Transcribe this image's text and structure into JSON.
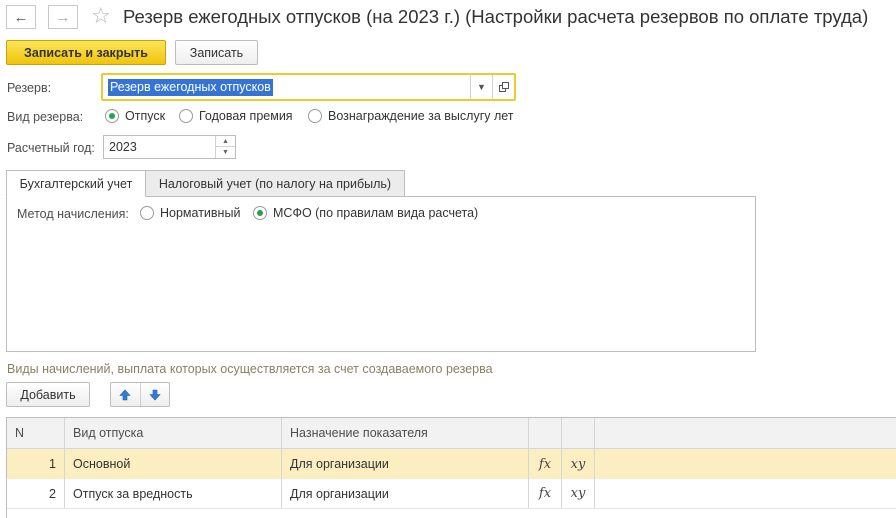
{
  "window": {
    "title": "Резерв ежегодных отпусков (на 2023 г.) (Настройки расчета резервов по оплате труда)"
  },
  "toolbar": {
    "save_close_label": "Записать и закрыть",
    "save_label": "Записать"
  },
  "form": {
    "reserve_label": "Резерв:",
    "reserve_value": "Резерв ежегодных отпусков",
    "reserve_type_label": "Вид резерва:",
    "reserve_type_options": [
      "Отпуск",
      "Годовая премия",
      "Вознаграждение за выслугу лет"
    ],
    "reserve_type_selected": "Отпуск",
    "year_label": "Расчетный год:",
    "year_value": "2023"
  },
  "tabs": [
    {
      "label": "Бухгалтерский учет",
      "active": true
    },
    {
      "label": "Налоговый учет (по налогу на прибыль)",
      "active": false
    }
  ],
  "accounting": {
    "method_label": "Метод начисления:",
    "method_options": [
      "Нормативный",
      "МСФО (по правилам вида расчета)"
    ],
    "method_selected": "МСФО (по правилам вида расчета)"
  },
  "accruals": {
    "caption": "Виды начислений, выплата которых осуществляется за счет создаваемого резерва",
    "add_label": "Добавить",
    "columns": {
      "n": "N",
      "leave_type": "Вид отпуска",
      "purpose": "Назначение показателя"
    },
    "rows": [
      {
        "n": "1",
        "leave_type": "Основной",
        "purpose": "Для организации",
        "fx": "fx",
        "xy": "xy",
        "selected": true
      },
      {
        "n": "2",
        "leave_type": "Отпуск за вредность",
        "purpose": "Для организации",
        "fx": "fx",
        "xy": "xy",
        "selected": false
      }
    ]
  },
  "colors": {
    "accent_yellow": "#f1c40a",
    "focus_border": "#f0c92c",
    "selection_blue": "#3574d4",
    "radio_green": "#2aa04d",
    "row_highlight": "#fbeec1",
    "arrow_blue": "#2f7fd6"
  },
  "icons": {
    "back": "arrow-left-icon",
    "forward": "arrow-right-icon",
    "favorite": "star-icon",
    "dropdown": "chevron-down-icon",
    "open": "open-form-icon",
    "up": "arrow-up-icon",
    "down": "arrow-down-icon",
    "formula": "fx-icon",
    "variables": "xy-icon"
  }
}
